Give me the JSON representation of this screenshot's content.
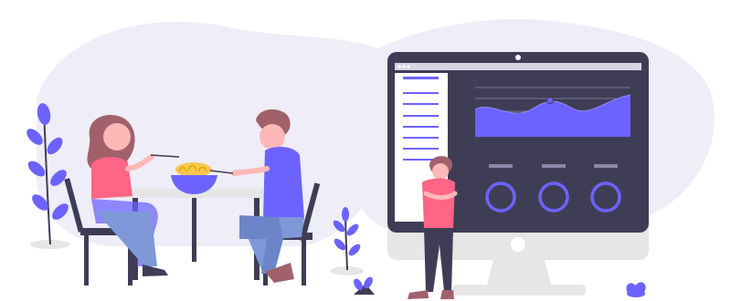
{
  "illustration": {
    "colors": {
      "bg_blob": "#eeedf8",
      "monitor_frame": "#3f3d56",
      "screen": "#3f3d56",
      "accent": "#6c63ff",
      "sidebar": "#ffffff",
      "stand": "#e6e6e6",
      "skin": "#ffb8b8",
      "shirt_red": "#ff6584",
      "hair": "#a0616a",
      "plant": "#6c63ff"
    },
    "icons": [
      "window-dots-icon",
      "area-chart-icon",
      "donut-chart-icon",
      "noodle-bowl-icon",
      "plant-icon"
    ],
    "dashboard": {
      "sidebar_items": 7,
      "donut_count": 3
    }
  }
}
